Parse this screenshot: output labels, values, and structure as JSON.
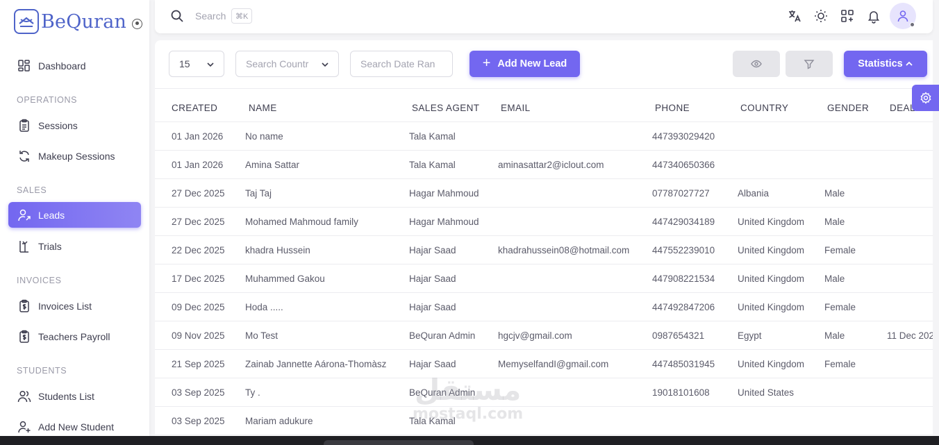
{
  "brand": {
    "name": "BeQuran"
  },
  "sidebar": {
    "items": [
      {
        "label": "Dashboard",
        "icon": "dashboard-icon"
      },
      {
        "label": "Sessions",
        "icon": "clipboard-icon"
      },
      {
        "label": "Makeup Sessions",
        "icon": "refresh-icon"
      },
      {
        "label": "Leads",
        "icon": "user-arrow-icon"
      },
      {
        "label": "Trials",
        "icon": "trial-icon"
      },
      {
        "label": "Invoices List",
        "icon": "invoice-icon"
      },
      {
        "label": "Teachers Payroll",
        "icon": "payroll-icon"
      },
      {
        "label": "Students List",
        "icon": "users-icon"
      },
      {
        "label": "Add New Student",
        "icon": "user-plus-icon"
      }
    ],
    "sections": [
      "OPERATIONS",
      "SALES",
      "INVOICES",
      "STUDENTS"
    ]
  },
  "topbar": {
    "search_placeholder": "Search",
    "shortcut": "⌘K"
  },
  "toolbar": {
    "page_size": "15",
    "country_placeholder": "Search Countr",
    "date_placeholder": "Search Date Ran",
    "add_lead_label": "Add New Lead",
    "statistics_label": "Statistics"
  },
  "table": {
    "columns": [
      "CREATED",
      "NAME",
      "SALES AGENT",
      "EMAIL",
      "PHONE",
      "COUNTRY",
      "GENDER",
      "DEAL"
    ],
    "rows": [
      [
        "01 Jan 2026",
        "No name",
        "Tala Kamal",
        "",
        "447393029420",
        "",
        "",
        ""
      ],
      [
        "01 Jan 2026",
        "Amina Sattar",
        "Tala Kamal",
        "aminasattar2@iclout.com",
        "447340650366",
        "",
        "",
        ""
      ],
      [
        "27 Dec 2025",
        "Taj Taj",
        "Hagar Mahmoud",
        "",
        "07787027727",
        "Albania",
        "Male",
        ""
      ],
      [
        "27 Dec 2025",
        "Mohamed Mahmoud family",
        "Hagar Mahmoud",
        "",
        "447429034189",
        "United Kingdom",
        "Male",
        ""
      ],
      [
        "22 Dec 2025",
        "khadra Hussein",
        "Hajar Saad",
        "khadrahussein08@hotmail.com",
        "447552239010",
        "United Kingdom",
        "Female",
        ""
      ],
      [
        "17 Dec 2025",
        "Muhammed Gakou",
        "Hajar Saad",
        "",
        "447908221534",
        "United Kingdom",
        "Male",
        ""
      ],
      [
        "09 Dec 2025",
        "Hoda .....",
        "Hajar Saad",
        "",
        "447492847206",
        "United Kingdom",
        "Female",
        ""
      ],
      [
        "09 Nov 2025",
        "Mo Test",
        "BeQuran Admin",
        "hgcjv@gmail.com",
        "0987654321",
        "Egypt",
        "Male",
        "11 Dec 202"
      ],
      [
        "21 Sep 2025",
        "Zainab Jannette Aárona-Thomàsz",
        "Hajar Saad",
        "MemyselfandI@gmail.com",
        "447485031945",
        "United Kingdom",
        "Female",
        ""
      ],
      [
        "03 Sep 2025",
        "Ty .",
        "BeQuran Admin",
        "",
        "19018101608",
        "United States",
        "",
        ""
      ],
      [
        "03 Sep 2025",
        "Mariam adukure",
        "Tala Kamal",
        "",
        "",
        "",
        "",
        ""
      ]
    ]
  },
  "watermark": {
    "line1": "مستقل",
    "line2": "mostaql.com"
  },
  "colors": {
    "primary": "#7367f0",
    "brand": "#4f64c9"
  }
}
